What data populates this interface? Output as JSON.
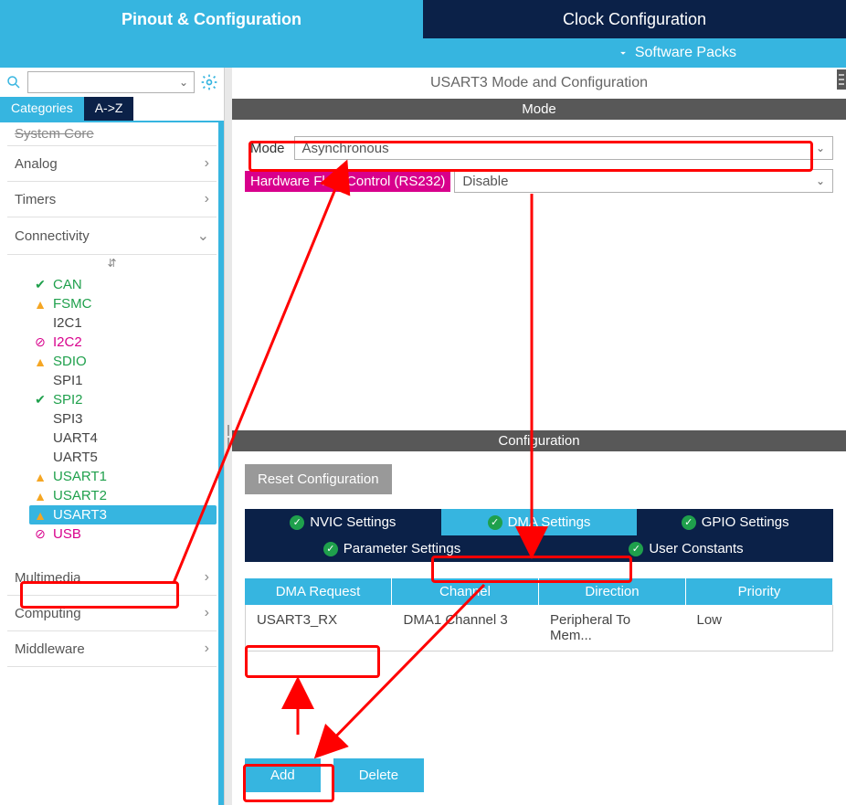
{
  "top_tabs": {
    "pinout": "Pinout & Configuration",
    "clock": "Clock Configuration"
  },
  "sub_bar": {
    "label": "Software Packs"
  },
  "left": {
    "tabs": {
      "categories": "Categories",
      "az": "A->Z"
    },
    "top_cut": "System Core",
    "categories": {
      "analog": "Analog",
      "timers": "Timers",
      "connectivity": "Connectivity",
      "multimedia": "Multimedia",
      "computing": "Computing",
      "middleware": "Middleware"
    },
    "peripherals": [
      {
        "name": "CAN",
        "icon": "check",
        "cls": "green"
      },
      {
        "name": "FSMC",
        "icon": "warn",
        "cls": "green"
      },
      {
        "name": "I2C1",
        "icon": "",
        "cls": "gray"
      },
      {
        "name": "I2C2",
        "icon": "prohibit",
        "cls": "magenta"
      },
      {
        "name": "SDIO",
        "icon": "warn",
        "cls": "green"
      },
      {
        "name": "SPI1",
        "icon": "",
        "cls": "gray"
      },
      {
        "name": "SPI2",
        "icon": "check",
        "cls": "green"
      },
      {
        "name": "SPI3",
        "icon": "",
        "cls": "gray"
      },
      {
        "name": "UART4",
        "icon": "",
        "cls": "gray"
      },
      {
        "name": "UART5",
        "icon": "",
        "cls": "gray"
      },
      {
        "name": "USART1",
        "icon": "warn",
        "cls": "green"
      },
      {
        "name": "USART2",
        "icon": "warn",
        "cls": "green"
      },
      {
        "name": "USART3",
        "icon": "warn",
        "cls": "selected"
      },
      {
        "name": "USB",
        "icon": "prohibit",
        "cls": "magenta"
      }
    ]
  },
  "right": {
    "title": "USART3 Mode and Configuration",
    "mode_header": "Mode",
    "mode_label": "Mode",
    "mode_value": "Asynchronous",
    "hwflow_label": "Hardware Flow Control (RS232)",
    "hwflow_value": "Disable",
    "config_header": "Configuration",
    "reset_btn": "Reset Configuration",
    "cfg_tabs": {
      "nvic": "NVIC Settings",
      "dma": "DMA Settings",
      "gpio": "GPIO Settings",
      "param": "Parameter Settings",
      "user": "User Constants"
    },
    "dma_headers": {
      "req": "DMA Request",
      "ch": "Channel",
      "dir": "Direction",
      "prio": "Priority"
    },
    "dma_row": {
      "req": "USART3_RX",
      "ch": "DMA1 Channel 3",
      "dir": "Peripheral To Mem...",
      "prio": "Low"
    },
    "add_btn": "Add",
    "del_btn": "Delete"
  }
}
